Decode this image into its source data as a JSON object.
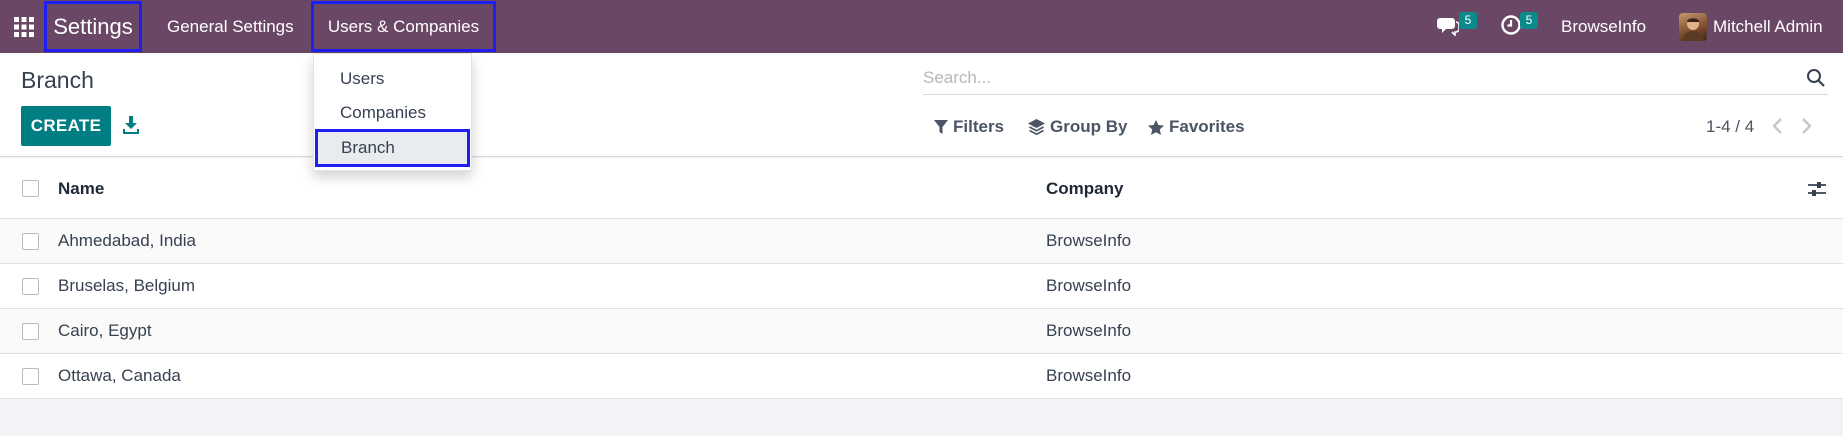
{
  "topbar": {
    "app_title": "Settings",
    "menus": [
      "General Settings",
      "Users & Companies"
    ],
    "messages_badge": "5",
    "activities_badge": "5",
    "company": "BrowseInfo",
    "user": "Mitchell Admin",
    "bar_color": "#6b4766"
  },
  "dropdown": {
    "items": [
      "Users",
      "Companies",
      "Branch"
    ],
    "active": "Branch"
  },
  "control_panel": {
    "title": "Branch",
    "create_label": "CREATE",
    "search_placeholder": "Search...",
    "filters_label": "Filters",
    "group_by_label": "Group By",
    "favorites_label": "Favorites",
    "pager": "1-4 / 4",
    "accent": "#017e84"
  },
  "table": {
    "columns": [
      "Name",
      "Company"
    ],
    "rows": [
      {
        "name": "Ahmedabad, India",
        "company": "BrowseInfo"
      },
      {
        "name": "Bruselas, Belgium",
        "company": "BrowseInfo"
      },
      {
        "name": "Cairo, Egypt",
        "company": "BrowseInfo"
      },
      {
        "name": "Ottawa, Canada",
        "company": "BrowseInfo"
      }
    ]
  },
  "icons": [
    "apps-grid-icon",
    "chat-icon",
    "clock-icon",
    "download-icon",
    "search-icon",
    "filter-icon",
    "layers-icon",
    "star-icon",
    "chevron-left-icon",
    "chevron-right-icon",
    "optional-columns-icon"
  ]
}
